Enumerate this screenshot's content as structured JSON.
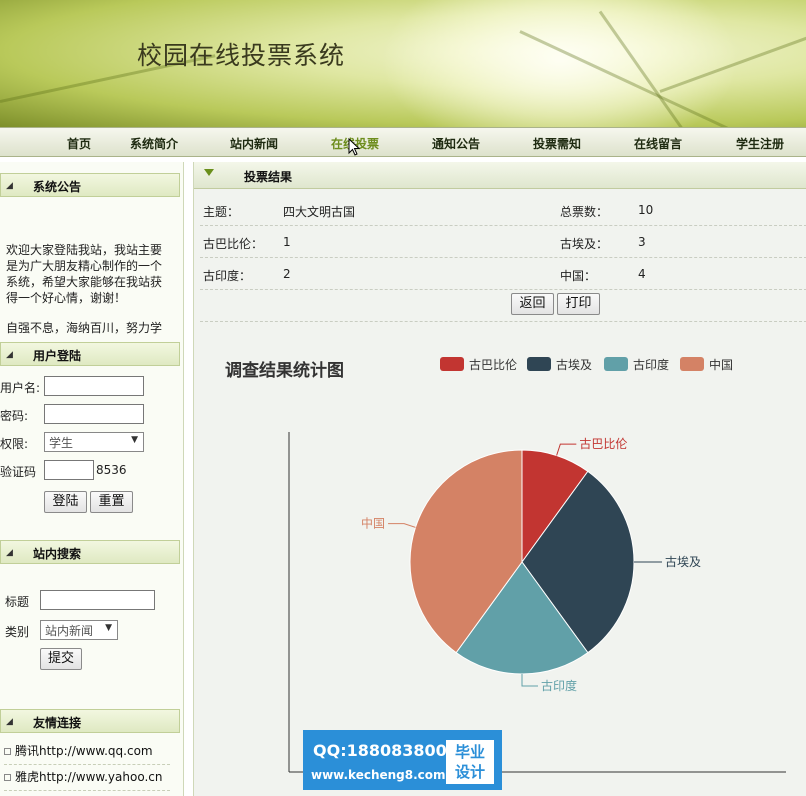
{
  "header": {
    "title": "校园在线投票系统"
  },
  "nav": {
    "items": [
      "首页",
      "系统简介",
      "站内新闻",
      "在线投票",
      "通知公告",
      "投票需知",
      "在线留言",
      "学生注册"
    ],
    "active_index": 3
  },
  "sidebar": {
    "announcement": {
      "heading": "系统公告",
      "text": "欢迎大家登陆我站，我站主要是为广大朋友精心制作的一个系统，希望大家能够在我站获得一个好心情，谢谢！",
      "motto": "自强不息，海纳百川，努力学"
    },
    "login": {
      "heading": "用户登陆",
      "username_label": "用户名:",
      "password_label": "密码:",
      "role_label": "权限:",
      "role_value": "学生",
      "captcha_label": "验证码",
      "captcha_code": "8536",
      "login_button": "登陆",
      "reset_button": "重置"
    },
    "search": {
      "heading": "站内搜索",
      "title_label": "标题",
      "category_label": "类别",
      "category_value": "站内新闻",
      "submit_button": "提交"
    },
    "links": {
      "heading": "友情连接",
      "items": [
        "腾讯http://www.qq.com",
        "雅虎http://www.yahoo.cn"
      ]
    }
  },
  "main": {
    "heading": "投票结果",
    "topic_label": "主题：",
    "topic_value": "四大文明古国",
    "total_label": "总票数：",
    "total_value": "10",
    "rows": [
      {
        "left_label": "古巴比伦：",
        "left_value": "1",
        "right_label": "古埃及：",
        "right_value": "3"
      },
      {
        "left_label": "古印度：",
        "left_value": "2",
        "right_label": "中国：",
        "right_value": "4"
      }
    ],
    "back_button": "返回",
    "print_button": "打印"
  },
  "chart_data": {
    "type": "pie",
    "title": "调查结果统计图",
    "categories": [
      "古巴比伦",
      "古埃及",
      "古印度",
      "中国"
    ],
    "values": [
      1,
      3,
      2,
      4
    ],
    "colors": [
      "#c23531",
      "#2f4554",
      "#61a0a8",
      "#d48265"
    ],
    "legend": "top"
  },
  "watermark": {
    "qq": "QQ:188083800",
    "site": "www.kecheng8.com",
    "badge_line1": "毕业",
    "badge_line2": "设计"
  }
}
